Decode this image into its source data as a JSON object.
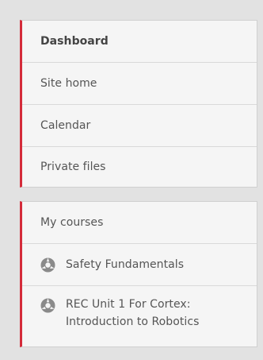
{
  "main_nav": {
    "items": [
      {
        "label": "Dashboard",
        "active": true
      },
      {
        "label": "Site home"
      },
      {
        "label": "Calendar"
      },
      {
        "label": "Private files"
      }
    ]
  },
  "courses_nav": {
    "heading": "My courses",
    "courses": [
      {
        "name": "Safety Fundamentals",
        "icon": "course-icon"
      },
      {
        "name_line1": "REC Unit 1 For Cortex:",
        "name_line2": "Introduction to Robotics",
        "icon": "course-icon"
      }
    ]
  },
  "colors": {
    "accent": "#d42b3a",
    "panel_bg": "#f5f5f5",
    "page_bg": "#e2e2e2",
    "text": "#555555"
  }
}
